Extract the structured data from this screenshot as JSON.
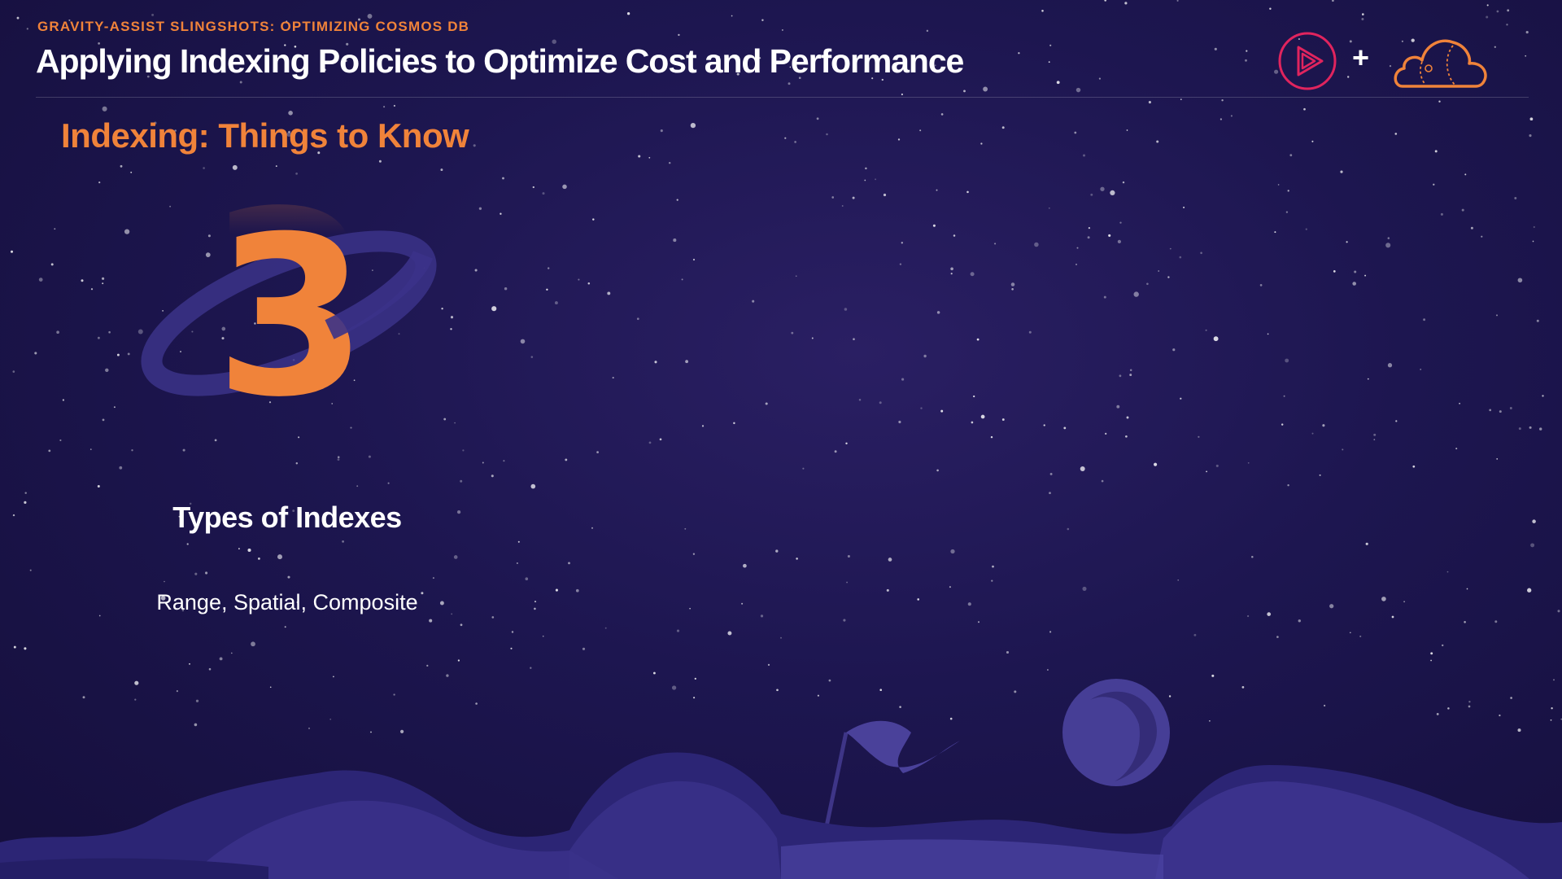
{
  "header": {
    "eyebrow": "GRAVITY-ASSIST SLINGSHOTS: OPTIMIZING COSMOS DB",
    "title": "Applying Indexing Policies to Optimize Cost and Performance",
    "plus": "+"
  },
  "section": {
    "heading": "Indexing: Things to Know"
  },
  "stat": {
    "number": "3",
    "label": "Types of Indexes",
    "detail": "Range, Spatial, Composite"
  },
  "colors": {
    "accent": "#f0833a",
    "background": "#1d1650",
    "play_logo": "#e0245e"
  },
  "icons": {
    "play": "play-logo-icon",
    "cloud": "cloud-logo-icon"
  }
}
